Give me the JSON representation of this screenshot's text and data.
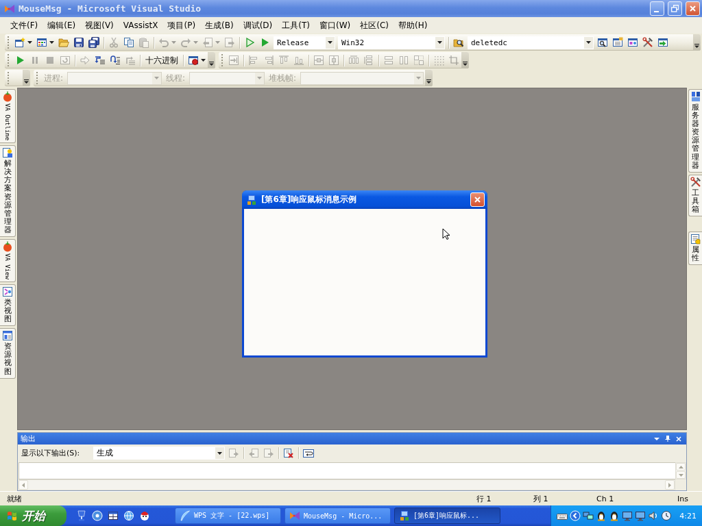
{
  "window": {
    "title": "MouseMsg - Microsoft Visual Studio"
  },
  "menu": [
    "文件(F)",
    "编辑(E)",
    "视图(V)",
    "VAssistX",
    "项目(P)",
    "生成(B)",
    "调试(D)",
    "工具(T)",
    "窗口(W)",
    "社区(C)",
    "帮助(H)"
  ],
  "toolbar_rows": [
    {
      "toolbars": [
        {
          "options_button": true,
          "items": [
            {
              "kind": "split-button",
              "disabled": false
            },
            {
              "kind": "split-button",
              "disabled": false
            },
            {
              "kind": "button",
              "disabled": false
            },
            {
              "kind": "button",
              "disabled": false
            },
            {
              "kind": "button",
              "disabled": false
            },
            {
              "kind": "separator"
            },
            {
              "kind": "button",
              "disabled": true
            },
            {
              "kind": "button",
              "disabled": false
            },
            {
              "kind": "button",
              "disabled": true
            },
            {
              "kind": "separator"
            },
            {
              "kind": "split-button",
              "disabled": true
            },
            {
              "kind": "split-button",
              "disabled": true
            },
            {
              "kind": "split-button",
              "disabled": true
            },
            {
              "kind": "button",
              "disabled": true
            },
            {
              "kind": "separator"
            },
            {
              "kind": "button",
              "disabled": false
            },
            {
              "kind": "button",
              "disabled": false
            },
            {
              "kind": "combo",
              "value": "Release",
              "disabled": false
            },
            {
              "kind": "combo",
              "value": "Win32",
              "disabled": false
            },
            {
              "kind": "separator"
            },
            {
              "kind": "button",
              "disabled": false
            },
            {
              "kind": "combo",
              "value": "deletedc",
              "disabled": false
            },
            {
              "kind": "button",
              "disabled": false
            },
            {
              "kind": "button",
              "disabled": false
            },
            {
              "kind": "button",
              "disabled": false
            },
            {
              "kind": "button",
              "disabled": false
            },
            {
              "kind": "button",
              "disabled": false
            }
          ]
        }
      ]
    },
    {
      "toolbars": [
        {
          "options_button": true,
          "items": [
            {
              "kind": "button",
              "disabled": false
            },
            {
              "kind": "button",
              "disabled": true
            },
            {
              "kind": "button",
              "disabled": true
            },
            {
              "kind": "button",
              "disabled": true
            },
            {
              "kind": "separator"
            },
            {
              "kind": "button",
              "disabled": true
            },
            {
              "kind": "button",
              "disabled": false
            },
            {
              "kind": "button",
              "disabled": false
            },
            {
              "kind": "button",
              "disabled": true
            },
            {
              "kind": "separator"
            },
            {
              "kind": "text-button",
              "text": "十六进制",
              "disabled": false
            },
            {
              "kind": "separator"
            },
            {
              "kind": "split-button",
              "disabled": false
            }
          ]
        },
        {
          "options_button": true,
          "items": [
            {
              "kind": "button",
              "disabled": true
            },
            {
              "kind": "separator"
            },
            {
              "kind": "button",
              "disabled": true
            },
            {
              "kind": "button",
              "disabled": true
            },
            {
              "kind": "button",
              "disabled": true
            },
            {
              "kind": "button",
              "disabled": true
            },
            {
              "kind": "separator"
            },
            {
              "kind": "button",
              "disabled": true
            },
            {
              "kind": "button",
              "disabled": true
            },
            {
              "kind": "separator"
            },
            {
              "kind": "button",
              "disabled": true
            },
            {
              "kind": "button",
              "disabled": true
            },
            {
              "kind": "separator"
            },
            {
              "kind": "button",
              "disabled": true
            },
            {
              "kind": "button",
              "disabled": true
            },
            {
              "kind": "button",
              "disabled": true
            },
            {
              "kind": "separator"
            },
            {
              "kind": "button",
              "disabled": true
            },
            {
              "kind": "button",
              "disabled": true
            }
          ]
        }
      ]
    },
    {
      "toolbars": [
        {
          "options_button": true
        },
        {
          "options_button": true,
          "items": [
            {
              "kind": "label",
              "text": "进程:",
              "disabled": true
            },
            {
              "kind": "combo",
              "disabled": true
            },
            {
              "kind": "label",
              "text": "线程:",
              "disabled": true
            },
            {
              "kind": "combo",
              "disabled": true
            },
            {
              "kind": "label",
              "text": "堆栈帧:",
              "disabled": true
            },
            {
              "kind": "combo",
              "disabled": true
            }
          ]
        }
      ]
    }
  ],
  "left_dock": [
    {
      "tabs": [
        {
          "kind": "rotated",
          "label": "VA Outline"
        },
        {
          "kind": "stacked",
          "label": "解决方案资源管理器"
        },
        {
          "kind": "rotated",
          "label": "VA View"
        },
        {
          "kind": "stacked",
          "label": "类视图"
        },
        {
          "kind": "stacked",
          "label": "资源视图"
        }
      ]
    }
  ],
  "right_dock": [
    {
      "tabs": [
        {
          "kind": "stacked",
          "label": "服务器资源管理器"
        },
        {
          "kind": "stacked",
          "label": "工具箱"
        }
      ]
    },
    {
      "tabs": [
        {
          "kind": "stacked",
          "label": "属性"
        }
      ]
    }
  ],
  "dialog": {
    "title": "[第6章]响应鼠标消息示例"
  },
  "output_panel": {
    "title": "输出",
    "show_output_label": "显示以下输出(S):",
    "source": "生成",
    "buttons": [
      {
        "kind": "button",
        "disabled": true
      },
      {
        "kind": "separator"
      },
      {
        "kind": "button",
        "disabled": true
      },
      {
        "kind": "button",
        "disabled": true
      },
      {
        "kind": "separator"
      },
      {
        "kind": "button",
        "disabled": false
      },
      {
        "kind": "separator"
      },
      {
        "kind": "button",
        "disabled": false
      }
    ]
  },
  "status_bar": {
    "message": "就绪",
    "line": "行 1",
    "column": "列 1",
    "char": "Ch 1",
    "mode": "Ins"
  },
  "taskbar": {
    "start": "开始",
    "tasks": [
      {
        "label": "WPS 文字 - [22.wps]",
        "selected": false
      },
      {
        "label": "MouseMsg - Micro...",
        "selected": false
      },
      {
        "label": "[第6章]响应鼠标...",
        "selected": true
      }
    ],
    "clock": "4:21"
  }
}
